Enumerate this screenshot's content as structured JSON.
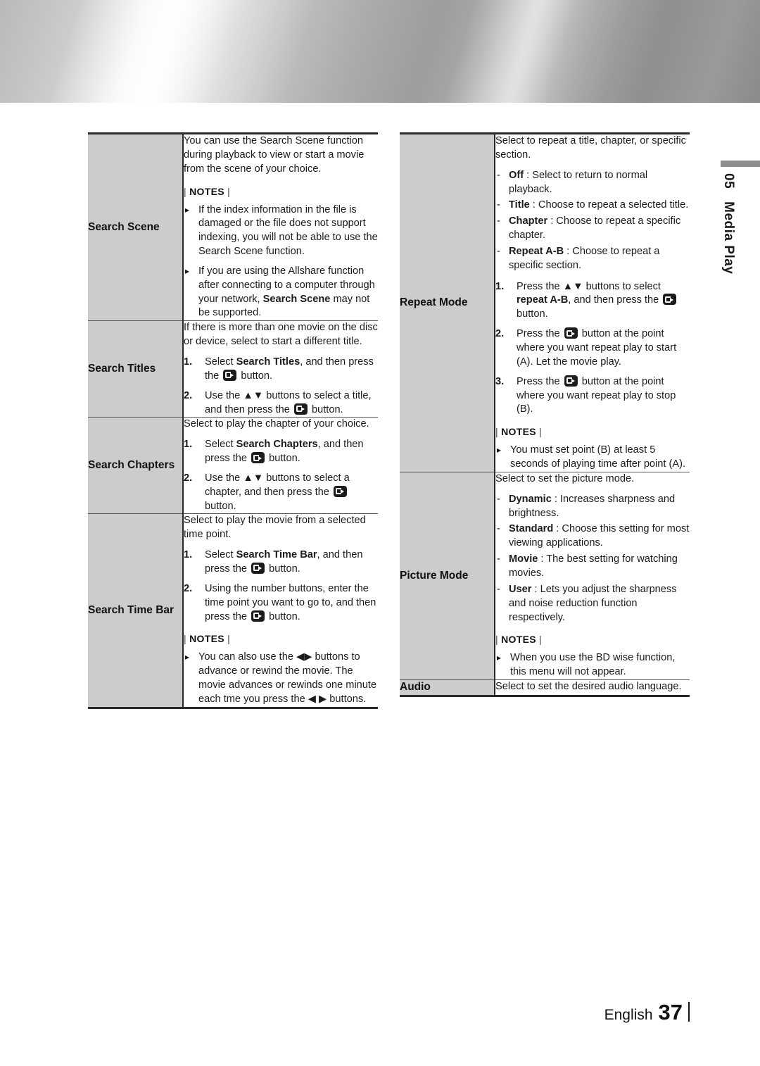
{
  "side_tab": {
    "chapter_number": "05",
    "chapter_title": "Media Play"
  },
  "footer": {
    "language": "English",
    "page_number": "37"
  },
  "notes_label": "NOTES",
  "icons": {
    "enter_button": "enter-button-icon",
    "up_down": "▲▼",
    "left_right": "◀▶",
    "left": "◀",
    "right": "▶",
    "bullet_triangle": "▸",
    "dash": "-"
  },
  "left_table": {
    "rows": [
      {
        "label": "Search Scene",
        "intro": "You can use the Search Scene function during playback to view or start a movie from the scene of your choice.",
        "notes": [
          "If the index information in the file is damaged or the file does not support indexing, you will not be able to use the Search Scene function.",
          "If you are using the Allshare function after connecting to a computer through your network, Search Scene may not be supported."
        ],
        "notes_bold_tail": "Search Scene"
      },
      {
        "label": "Search Titles",
        "intro": "If there is more than one movie on the disc or device, select to start a different title.",
        "steps": [
          {
            "num": "1.",
            "pre": "Select ",
            "bold": "Search Titles",
            "mid": ", and then press the ",
            "post": " button."
          },
          {
            "num": "2.",
            "pre": "Use the ▲▼ buttons to select a title, and then press the ",
            "bold": "",
            "mid": "",
            "post": " button."
          }
        ]
      },
      {
        "label": "Search Chapters",
        "intro": "Select to play the chapter of your choice.",
        "steps": [
          {
            "num": "1.",
            "pre": "Select ",
            "bold": "Search Chapters",
            "mid": ", and then press the ",
            "post": " button."
          },
          {
            "num": "2.",
            "pre": "Use the ▲▼ buttons to select a chapter, and then press the ",
            "bold": "",
            "mid": "",
            "post": " button."
          }
        ]
      },
      {
        "label": "Search Time Bar",
        "intro": "Select to play the movie from a selected time point.",
        "steps": [
          {
            "num": "1.",
            "pre": "Select ",
            "bold": "Search Time Bar",
            "mid": ", and then press the ",
            "post": " button."
          },
          {
            "num": "2.",
            "pre": "Using the number buttons, enter the time point you want to go to, and then press the ",
            "bold": "",
            "mid": "",
            "post": " button."
          }
        ],
        "notes": [
          "You can also use the ◀▶ buttons to advance or rewind the movie. The movie advances or rewinds one minute each tme you press the ◀ ▶ buttons."
        ]
      }
    ]
  },
  "right_table": {
    "rows": [
      {
        "label": "Repeat Mode",
        "intro": "Select to repeat a title, chapter, or specific section.",
        "options": [
          {
            "term": "Off",
            "desc": " : Select to return to normal playback."
          },
          {
            "term": "Title",
            "desc": " : Choose to repeat a selected title."
          },
          {
            "term": "Chapter",
            "desc": " : Choose to repeat a specific chapter."
          },
          {
            "term": "Repeat A-B",
            "desc": " : Choose to repeat a specific section."
          }
        ],
        "steps": [
          {
            "num": "1.",
            "pre": "Press the ▲▼ buttons to select ",
            "bold": "repeat A-B",
            "mid": ", and then press the ",
            "post": " button."
          },
          {
            "num": "2.",
            "pre": "Press the ",
            "post_a": " button at the point where you want repeat play to start (A). Let the movie play."
          },
          {
            "num": "3.",
            "pre": "Press the ",
            "post_a": " button at the point where you want repeat play to stop (B)."
          }
        ],
        "notes": [
          "You must set point (B) at least 5 seconds of playing time after point (A)."
        ]
      },
      {
        "label": "Picture Mode",
        "intro": "Select to set the picture mode.",
        "options": [
          {
            "term": "Dynamic",
            "desc": " : Increases sharpness and brightness."
          },
          {
            "term": "Standard",
            "desc": " : Choose this setting for most viewing applications."
          },
          {
            "term": "Movie",
            "desc": " : The best setting for watching movies."
          },
          {
            "term": "User",
            "desc": " : Lets you adjust the sharpness and noise reduction function respectively."
          }
        ],
        "notes": [
          "When you use the BD wise function, this menu will not appear."
        ]
      },
      {
        "label": "Audio",
        "intro": "Select to set the desired audio language."
      }
    ]
  }
}
